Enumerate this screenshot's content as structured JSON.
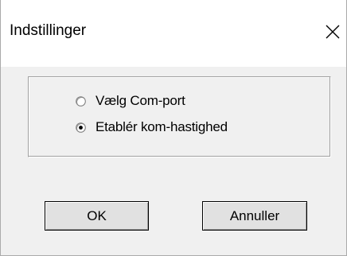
{
  "window": {
    "title": "Indstillinger",
    "close_icon": "close-icon"
  },
  "options": [
    {
      "label": "Vælg Com-port",
      "selected": false
    },
    {
      "label": "Etablér kom-hastighed",
      "selected": true
    }
  ],
  "buttons": {
    "ok_label": "OK",
    "cancel_label": "Annuller"
  },
  "colors": {
    "window_bg": "#f0f0f0",
    "titlebar_bg": "#ffffff",
    "button_bg": "#e1e1e1",
    "text": "#000000"
  }
}
